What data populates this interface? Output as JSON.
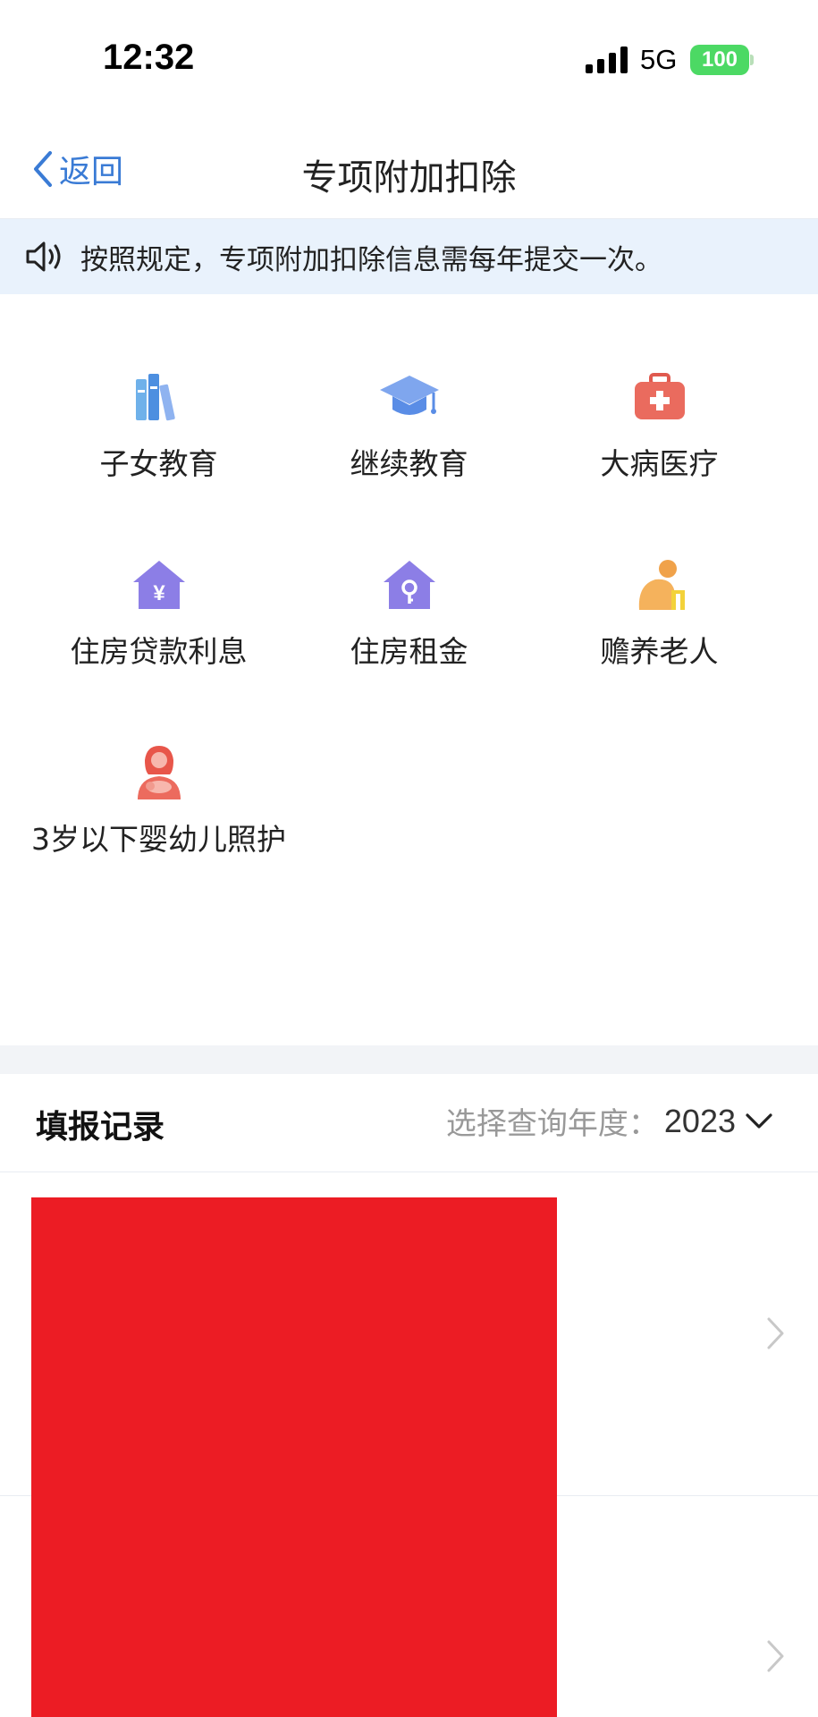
{
  "status_bar": {
    "time": "12:32",
    "network": "5G",
    "battery": "100",
    "battery_color": "#4cd964"
  },
  "nav": {
    "back_label": "返回",
    "title": "专项附加扣除",
    "accent": "#3a7bd5"
  },
  "notice": {
    "icon": "speaker-icon",
    "text": "按照规定，专项附加扣除信息需每年提交一次。"
  },
  "deductions": [
    {
      "icon": "books-icon",
      "label": "子女教育"
    },
    {
      "icon": "graduation-cap-icon",
      "label": "继续教育"
    },
    {
      "icon": "medical-kit-icon",
      "label": "大病医疗"
    },
    {
      "icon": "house-yen-icon",
      "label": "住房贷款利息"
    },
    {
      "icon": "house-key-icon",
      "label": "住房租金"
    },
    {
      "icon": "elderly-person-icon",
      "label": "赡养老人"
    },
    {
      "icon": "mother-baby-icon",
      "label": "3岁以下婴幼儿照护"
    }
  ],
  "records": {
    "title": "填报记录",
    "year_label": "选择查询年度：",
    "year_value": "2023"
  }
}
